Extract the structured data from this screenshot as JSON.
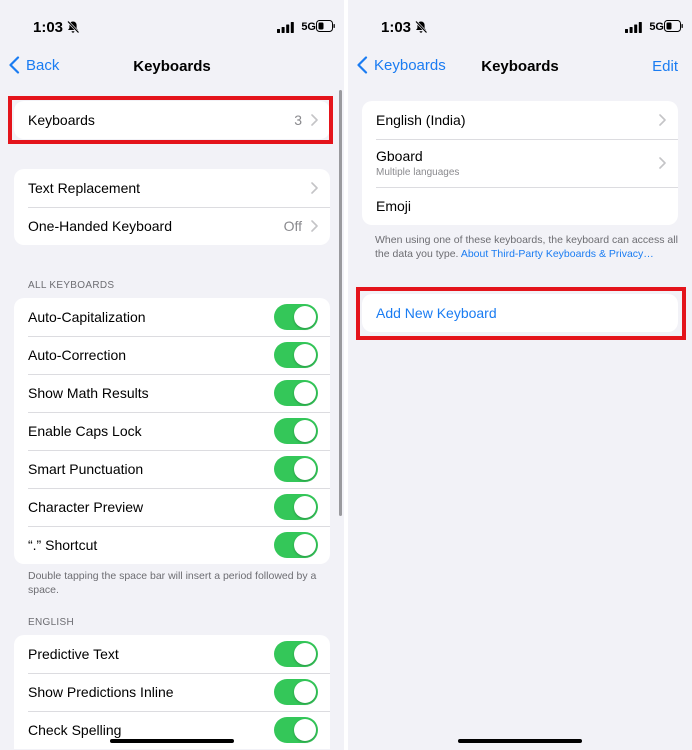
{
  "left": {
    "status": {
      "time": "1:03",
      "network": "5G"
    },
    "nav": {
      "back_label": "Back",
      "title": "Keyboards"
    },
    "keyboards_row": {
      "label": "Keyboards",
      "value": "3"
    },
    "group2": [
      {
        "label": "Text Replacement",
        "value": ""
      },
      {
        "label": "One-Handed Keyboard",
        "value": "Off"
      }
    ],
    "all_keyboards": {
      "header": "ALL KEYBOARDS",
      "items": [
        {
          "label": "Auto-Capitalization",
          "on": true
        },
        {
          "label": "Auto-Correction",
          "on": true
        },
        {
          "label": "Show Math Results",
          "on": true
        },
        {
          "label": "Enable Caps Lock",
          "on": true
        },
        {
          "label": "Smart Punctuation",
          "on": true
        },
        {
          "label": "Character Preview",
          "on": true
        },
        {
          "label": "“.” Shortcut",
          "on": true
        }
      ],
      "footnote": "Double tapping the space bar will insert a period followed by a space."
    },
    "english": {
      "header": "ENGLISH",
      "items": [
        {
          "label": "Predictive Text",
          "on": true
        },
        {
          "label": "Show Predictions Inline",
          "on": true
        },
        {
          "label": "Check Spelling",
          "on": true
        }
      ]
    }
  },
  "right": {
    "status": {
      "time": "1:03",
      "network": "5G"
    },
    "nav": {
      "back_label": "Keyboards",
      "title": "Keyboards",
      "edit_label": "Edit"
    },
    "keyboards": [
      {
        "label": "English (India)",
        "sublabel": "",
        "chevron": true
      },
      {
        "label": "Gboard",
        "sublabel": "Multiple languages",
        "chevron": true
      },
      {
        "label": "Emoji",
        "sublabel": "",
        "chevron": false
      }
    ],
    "footnote_text": "When using one of these keyboards, the keyboard can access all the data you type. ",
    "footnote_link": "About Third-Party Keyboards & Privacy…",
    "add_keyboard_label": "Add New Keyboard"
  },
  "colors": {
    "accent": "#1a7cf2",
    "toggle_on": "#34c759",
    "highlight": "#e4141b",
    "background": "#f2f2f7"
  }
}
